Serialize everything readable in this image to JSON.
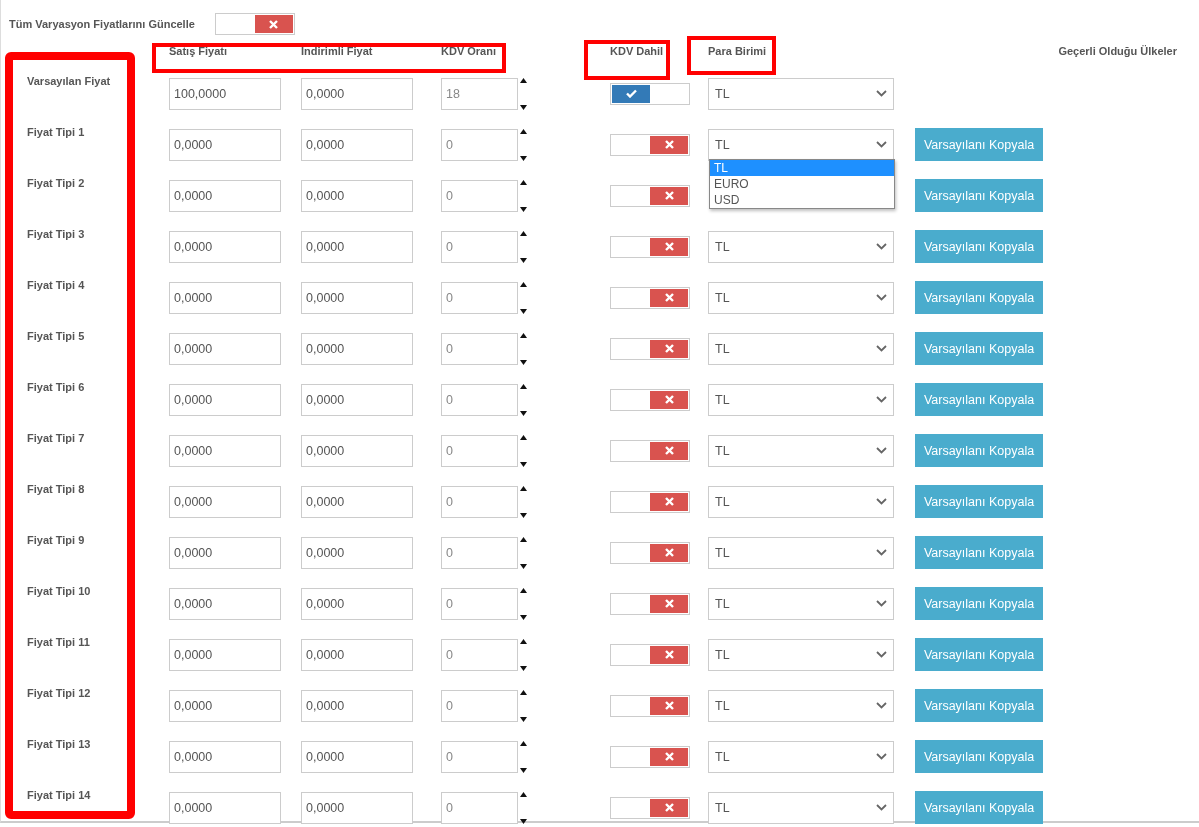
{
  "update_all": {
    "label": "Tüm Varyasyon Fiyatlarını Güncelle",
    "on": false
  },
  "columns": {
    "sale_price": "Satış Fiyatı",
    "discount_price": "İndirimli Fiyat",
    "vat_rate": "KDV Oranı",
    "vat_included": "KDV Dahil",
    "currency": "Para Birimi",
    "countries": "Geçerli Olduğu Ülkeler"
  },
  "rows": [
    {
      "label": "Varsayılan Fiyat",
      "sale_price": "100,0000",
      "discount_price": "0,0000",
      "vat_rate": "18",
      "vat_included": true,
      "currency": "TL"
    },
    {
      "label": "Fiyat Tipi 1",
      "sale_price": "0,0000",
      "discount_price": "0,0000",
      "vat_rate": "0",
      "vat_included": false,
      "currency": "TL",
      "copy_button": "Varsayılanı Kopyala",
      "dropdown": [
        {
          "label": "TL",
          "selected": true
        },
        {
          "label": "EURO",
          "selected": false
        },
        {
          "label": "USD",
          "selected": false
        }
      ]
    },
    {
      "label": "Fiyat Tipi 2",
      "sale_price": "0,0000",
      "discount_price": "0,0000",
      "vat_rate": "0",
      "vat_included": false,
      "copy_button": "Varsayılanı Kopyala"
    },
    {
      "label": "Fiyat Tipi 3",
      "sale_price": "0,0000",
      "discount_price": "0,0000",
      "vat_rate": "0",
      "vat_included": false,
      "currency": "TL",
      "copy_button": "Varsayılanı Kopyala"
    },
    {
      "label": "Fiyat Tipi 4",
      "sale_price": "0,0000",
      "discount_price": "0,0000",
      "vat_rate": "0",
      "vat_included": false,
      "currency": "TL",
      "copy_button": "Varsayılanı Kopyala"
    },
    {
      "label": "Fiyat Tipi 5",
      "sale_price": "0,0000",
      "discount_price": "0,0000",
      "vat_rate": "0",
      "vat_included": false,
      "currency": "TL",
      "copy_button": "Varsayılanı Kopyala"
    },
    {
      "label": "Fiyat Tipi 6",
      "sale_price": "0,0000",
      "discount_price": "0,0000",
      "vat_rate": "0",
      "vat_included": false,
      "currency": "TL",
      "copy_button": "Varsayılanı Kopyala"
    },
    {
      "label": "Fiyat Tipi 7",
      "sale_price": "0,0000",
      "discount_price": "0,0000",
      "vat_rate": "0",
      "vat_included": false,
      "currency": "TL",
      "copy_button": "Varsayılanı Kopyala"
    },
    {
      "label": "Fiyat Tipi 8",
      "sale_price": "0,0000",
      "discount_price": "0,0000",
      "vat_rate": "0",
      "vat_included": false,
      "currency": "TL",
      "copy_button": "Varsayılanı Kopyala"
    },
    {
      "label": "Fiyat Tipi 9",
      "sale_price": "0,0000",
      "discount_price": "0,0000",
      "vat_rate": "0",
      "vat_included": false,
      "currency": "TL",
      "copy_button": "Varsayılanı Kopyala"
    },
    {
      "label": "Fiyat Tipi 10",
      "sale_price": "0,0000",
      "discount_price": "0,0000",
      "vat_rate": "0",
      "vat_included": false,
      "currency": "TL",
      "copy_button": "Varsayılanı Kopyala"
    },
    {
      "label": "Fiyat Tipi 11",
      "sale_price": "0,0000",
      "discount_price": "0,0000",
      "vat_rate": "0",
      "vat_included": false,
      "currency": "TL",
      "copy_button": "Varsayılanı Kopyala"
    },
    {
      "label": "Fiyat Tipi 12",
      "sale_price": "0,0000",
      "discount_price": "0,0000",
      "vat_rate": "0",
      "vat_included": false,
      "currency": "TL",
      "copy_button": "Varsayılanı Kopyala"
    },
    {
      "label": "Fiyat Tipi 13",
      "sale_price": "0,0000",
      "discount_price": "0,0000",
      "vat_rate": "0",
      "vat_included": false,
      "currency": "TL",
      "copy_button": "Varsayılanı Kopyala"
    },
    {
      "label": "Fiyat Tipi 14",
      "sale_price": "0,0000",
      "discount_price": "0,0000",
      "vat_rate": "0",
      "vat_included": false,
      "currency": "TL",
      "copy_button": "Varsayılanı Kopyala"
    }
  ]
}
